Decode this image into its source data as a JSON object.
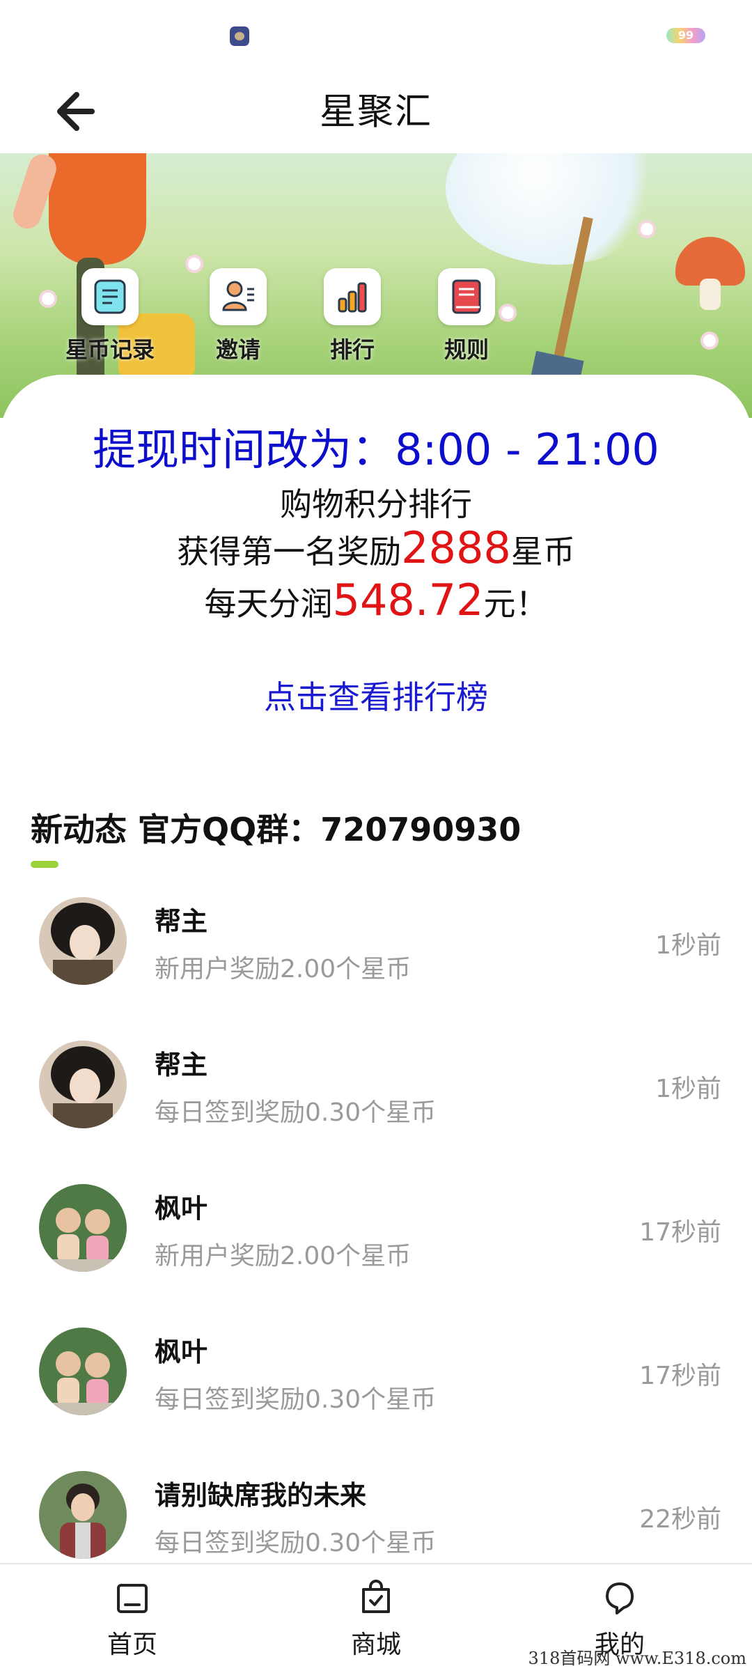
{
  "status_bar": {
    "battery_level": "99"
  },
  "header": {
    "title": "星聚汇"
  },
  "quick_menu": [
    {
      "label": "星币记录",
      "icon": "document-icon"
    },
    {
      "label": "邀请",
      "icon": "invite-user-icon"
    },
    {
      "label": "排行",
      "icon": "bar-chart-icon"
    },
    {
      "label": "规则",
      "icon": "rule-book-icon"
    }
  ],
  "notice": {
    "headline": "提现时间改为：8:00 - 21:00",
    "line1": "购物积分排行",
    "line2_prefix": "获得第一名奖励",
    "line2_amount": "2888",
    "line2_suffix": "星币",
    "line3_prefix": "每天分润",
    "line3_amount": "548.72",
    "line3_suffix": "元！",
    "ranking_link": "点击查看排行榜"
  },
  "feed": {
    "title": "新动态 官方QQ群：720790930",
    "items": [
      {
        "name": "帮主",
        "desc": "新用户奖励2.00个星币",
        "time": "1秒前"
      },
      {
        "name": "帮主",
        "desc": "每日签到奖励0.30个星币",
        "time": "1秒前"
      },
      {
        "name": "枫叶",
        "desc": "新用户奖励2.00个星币",
        "time": "17秒前"
      },
      {
        "name": "枫叶",
        "desc": "每日签到奖励0.30个星币",
        "time": "17秒前"
      },
      {
        "name": "请别缺席我的未来",
        "desc": "每日签到奖励0.30个星币",
        "time": "22秒前"
      }
    ]
  },
  "bottom_nav": [
    {
      "label": "首页",
      "icon": "home-icon"
    },
    {
      "label": "商城",
      "icon": "shopping-bag-icon"
    },
    {
      "label": "我的",
      "icon": "profile-icon"
    }
  ],
  "watermark": "318首码网 www.E318.com"
}
